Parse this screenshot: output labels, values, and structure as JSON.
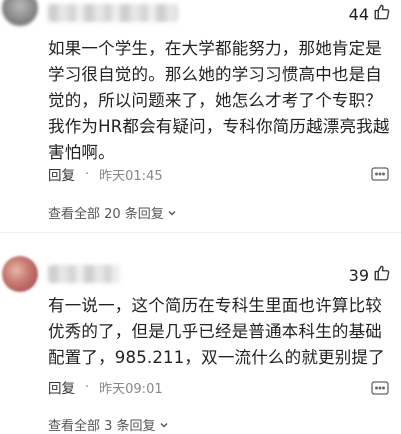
{
  "comments": [
    {
      "likes": "44",
      "text": "如果一个学生，在大学都能努力，那她肯定是学习很自觉的。那么她的学习习惯高中也是自觉的，所以问题来了，她怎么才考了个专职？ 我作为HR都会有疑问，专科你简历越漂亮我越害怕啊。",
      "reply_label": "回复",
      "time": "昨天01:45",
      "view_replies": "查看全部 20 条回复"
    },
    {
      "likes": "39",
      "text": "有一说一，这个简历在专科生里面也许算比较优秀的了，但是几乎已经是普通本科生的基础配置了，985.211，双一流什么的就更别提了",
      "reply_label": "回复",
      "time": "昨天09:01",
      "view_replies": "查看全部 3 条回复"
    }
  ],
  "colors": {
    "text": "#222222",
    "meta": "#888888"
  },
  "icons": {
    "like": "thumbs-up-icon",
    "more": "more-icon",
    "expand": "chevron-down-icon"
  }
}
